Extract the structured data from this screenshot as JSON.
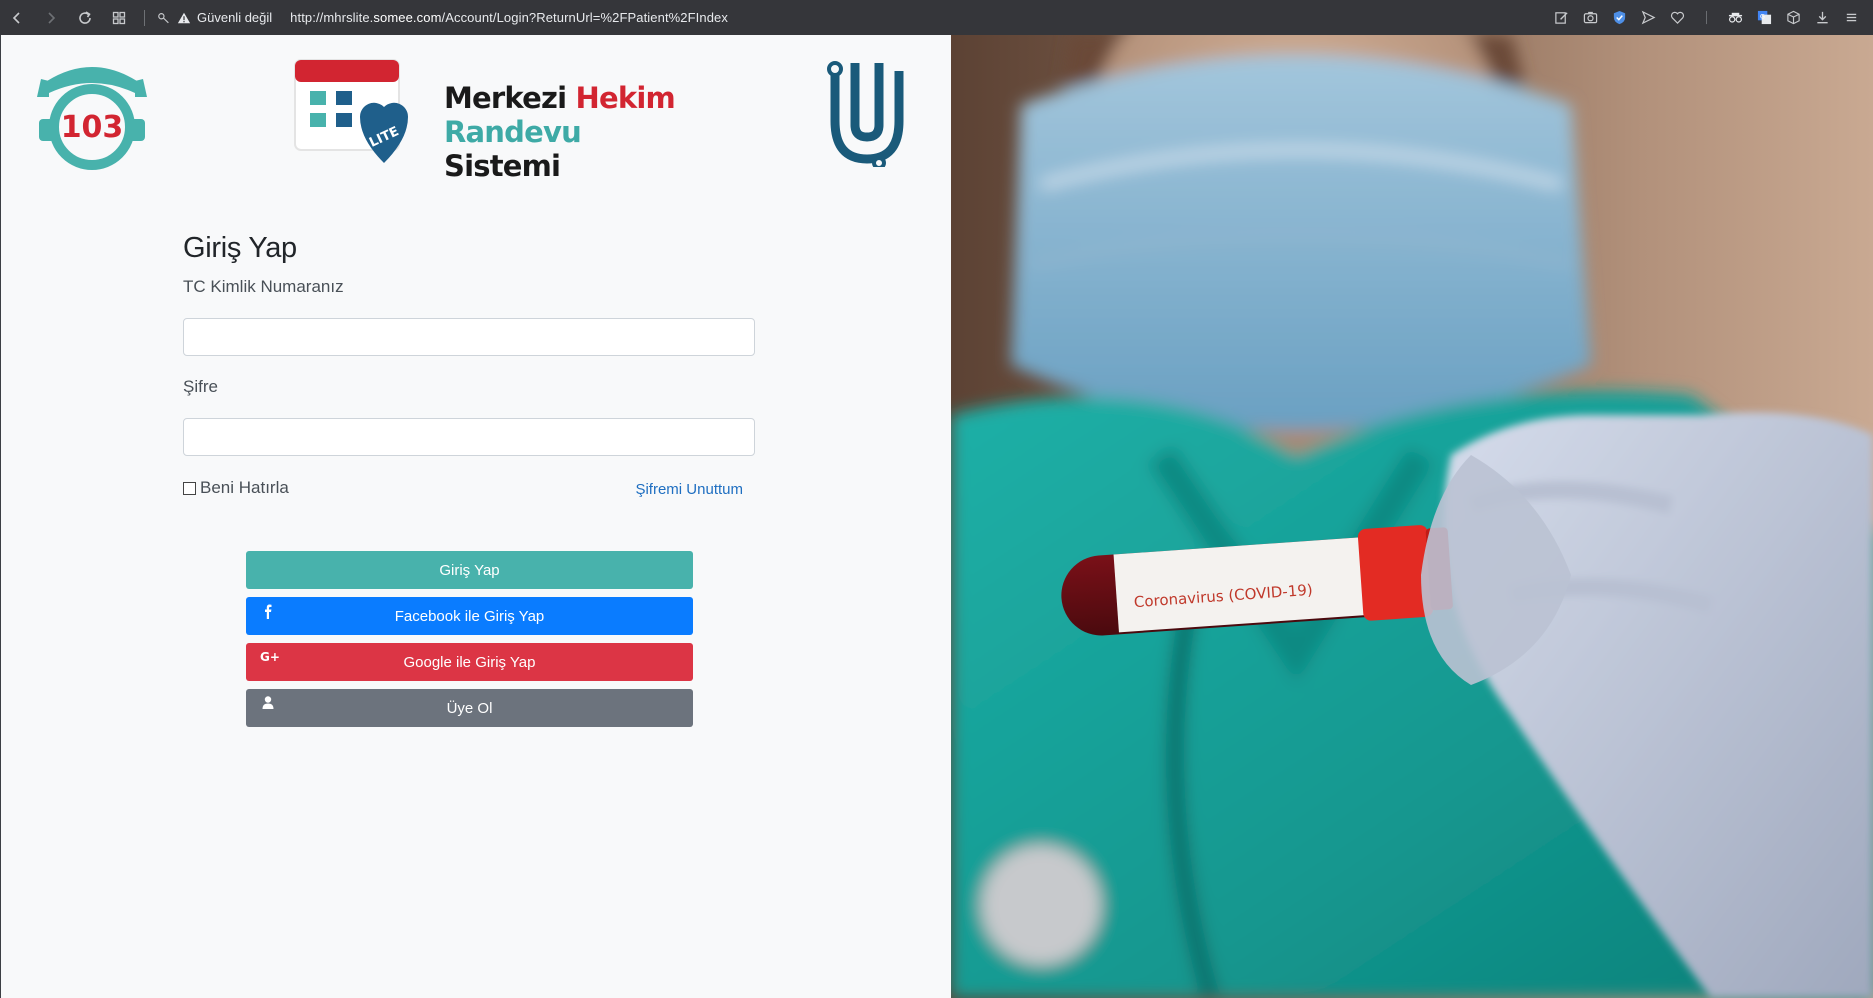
{
  "browser": {
    "security_label": "Güvenli değil",
    "url_prefix": "http://mhrslite.",
    "url_host": "somee.com",
    "url_path": "/Account/Login?ReturnUrl=%2FPatient%2FIndex"
  },
  "logos": {
    "hotline_number": "103",
    "brand_line1a": "Merkezi ",
    "brand_line1b": "Hekim",
    "brand_line2a": "Randevu ",
    "brand_line2b": "Sistemi",
    "badge": "LITE"
  },
  "form": {
    "title": "Giriş Yap",
    "tc_label": "TC Kimlik Numaranız",
    "tc_value": "",
    "password_label": "Şifre",
    "password_value": "",
    "remember_label": "Beni Hatırla",
    "forgot_label": "Şifremi Unuttum"
  },
  "buttons": {
    "login": "Giriş Yap",
    "facebook": "Facebook ile Giriş Yap",
    "google": "Google ile Giriş Yap",
    "register": "Üye Ol"
  },
  "hero": {
    "tube_label": "Coronavirus (COVID-19)"
  },
  "colors": {
    "accent": "#48b2ac",
    "facebook": "#0a7cff",
    "google": "#dc3545",
    "register": "#6c737d",
    "link": "#1f6fc1"
  }
}
